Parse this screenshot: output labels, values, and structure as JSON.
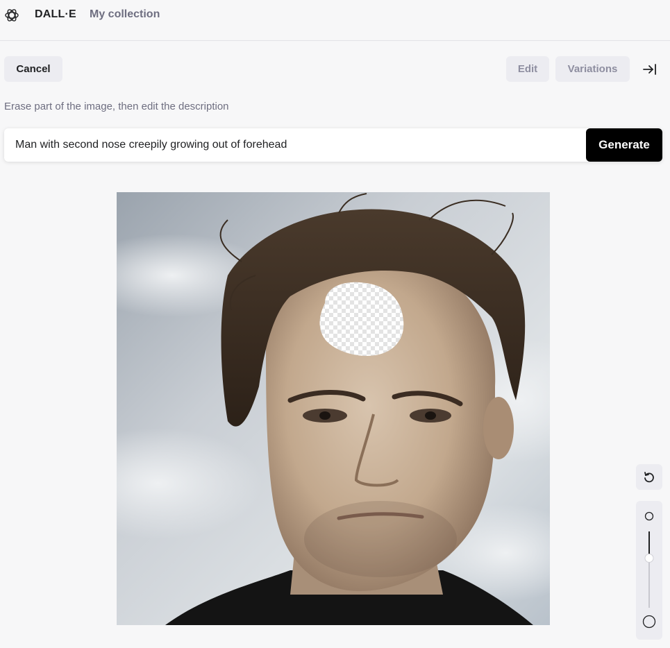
{
  "header": {
    "brand": "DALL·E",
    "collection_link": "My collection"
  },
  "toolbar": {
    "cancel_label": "Cancel",
    "edit_label": "Edit",
    "variations_label": "Variations"
  },
  "editor": {
    "hint": "Erase part of the image, then edit the description",
    "prompt_value": "Man with second nose creepily growing out of forehead",
    "generate_label": "Generate"
  },
  "brush": {
    "size_level": 0.35
  },
  "icons": {
    "logo": "openai-logo-icon",
    "collapse": "collapse-panel-icon",
    "reset": "undo-icon",
    "brush_small": "brush-small-icon",
    "brush_large": "brush-large-icon"
  },
  "colors": {
    "primary": "#000000",
    "button_bg": "#ececf1",
    "background": "#f7f7f8",
    "muted_text": "#6e6e80"
  }
}
